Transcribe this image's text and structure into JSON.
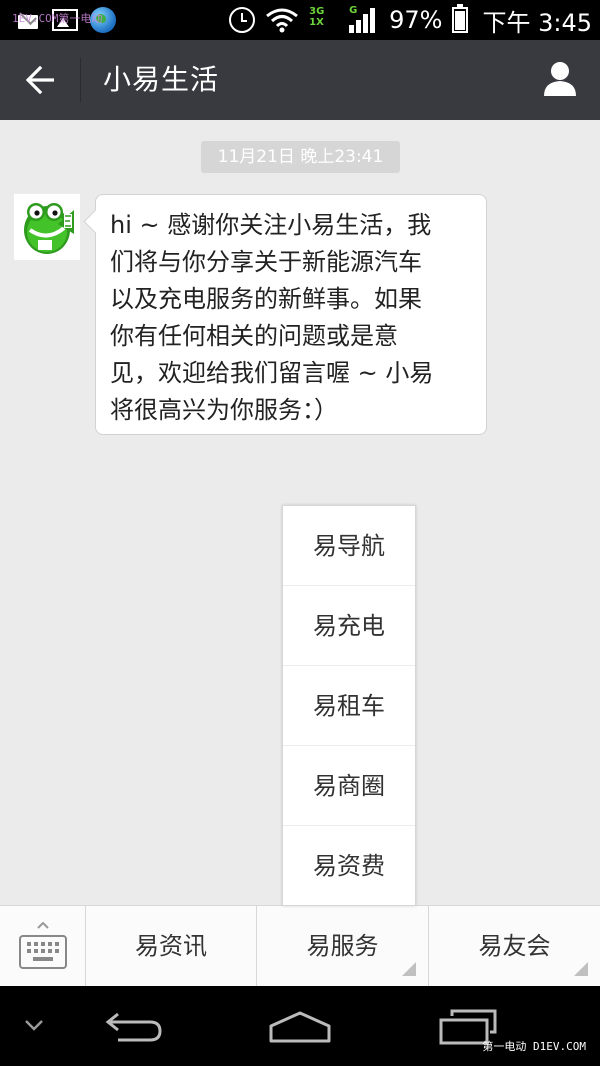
{
  "status_bar": {
    "watermark": "1EV.COM第一电动",
    "network_top": "3G",
    "network_bottom": "1X",
    "signal_type": "G",
    "battery_percent": "97%",
    "time": "下午 3:45"
  },
  "header": {
    "title": "小易生活"
  },
  "chat": {
    "timestamp": "11月21日 晚上23:41",
    "messages": [
      {
        "lines": [
          "hi ~ 感谢你关注小易生活，我",
          "们将与你分享关于新能源汽车",
          "以及充电服务的新鲜事。如果",
          "你有任何相关的问题或是意",
          "见，欢迎给我们留言喔 ~ 小易",
          "将很高兴为你服务：）"
        ]
      }
    ]
  },
  "popup_menu": {
    "items": [
      "易导航",
      "易充电",
      "易租车",
      "易商圈",
      "易资费"
    ]
  },
  "bottom_menu": {
    "items": [
      "易资讯",
      "易服务",
      "易友会"
    ]
  },
  "footer": {
    "watermark": "第一电动 D1EV.COM"
  },
  "colors": {
    "title_bar": "#393a3f",
    "chat_bg": "#ebebeb",
    "status_bar": "#000000",
    "network_green": "#6cd43a"
  }
}
